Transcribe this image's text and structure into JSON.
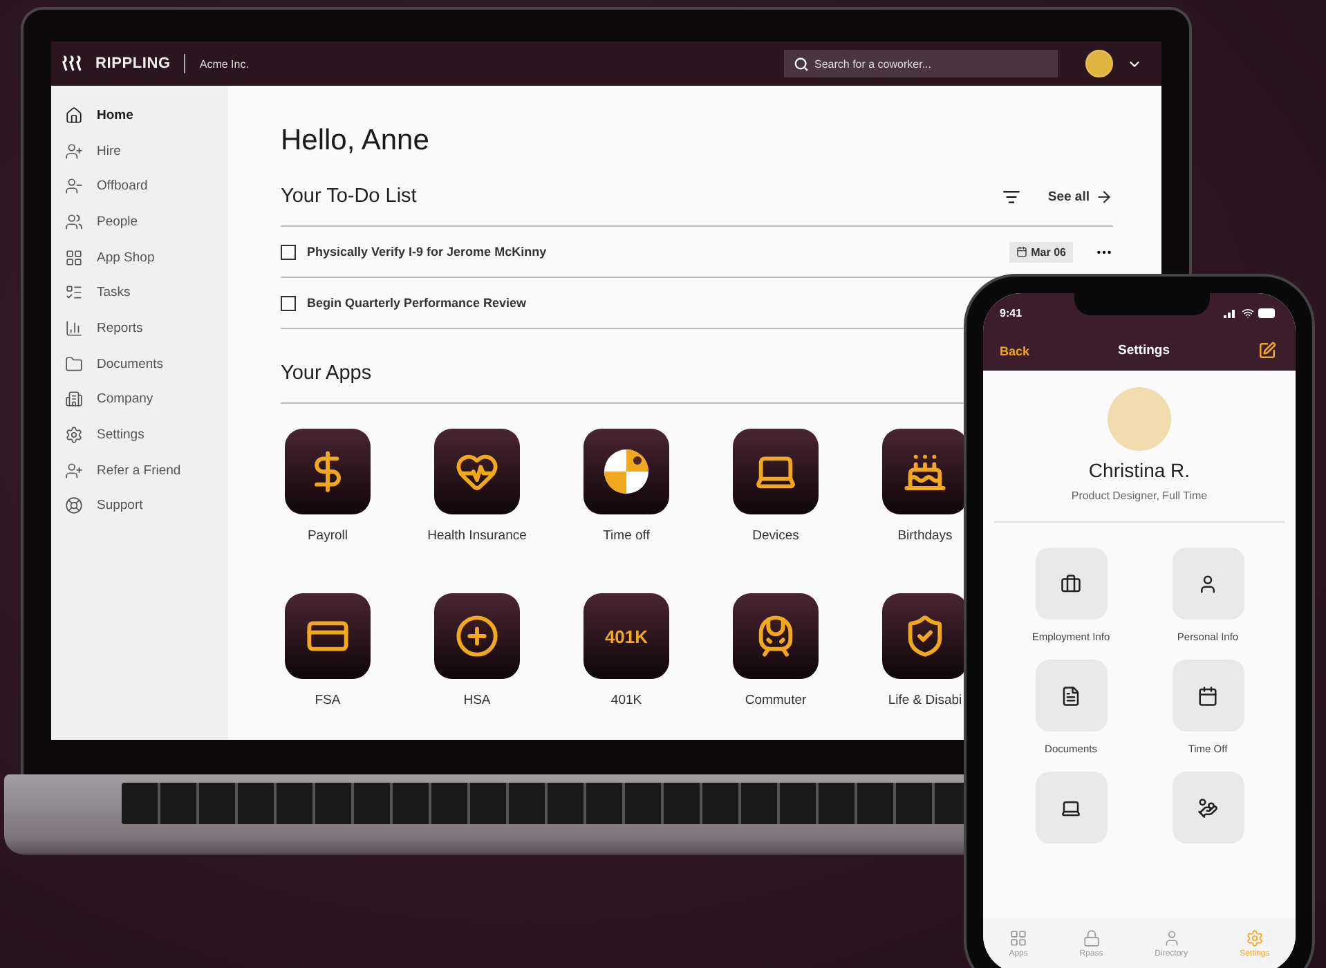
{
  "laptop": {
    "brand": "RIPPLING",
    "company": "Acme Inc.",
    "search": {
      "placeholder": "Search for a coworker..."
    }
  },
  "sidebar": {
    "items": [
      {
        "label": "Home",
        "kind": "home",
        "selected": true
      },
      {
        "label": "Hire",
        "kind": "hire",
        "selected": false
      },
      {
        "label": "Offboard",
        "kind": "offboard",
        "selected": false
      },
      {
        "label": "People",
        "kind": "people",
        "selected": false
      },
      {
        "label": "App Shop",
        "kind": "shop",
        "selected": false
      },
      {
        "label": "Tasks",
        "kind": "tasks",
        "selected": false
      },
      {
        "label": "Reports",
        "kind": "reports",
        "selected": false
      },
      {
        "label": "Documents",
        "kind": "documents",
        "selected": false
      },
      {
        "label": "Company",
        "kind": "company",
        "selected": false
      },
      {
        "label": "Settings",
        "kind": "settings",
        "selected": false
      },
      {
        "label": "Refer a Friend",
        "kind": "hire",
        "selected": false
      },
      {
        "label": "Support",
        "kind": "support",
        "selected": false
      }
    ]
  },
  "greeting": "Hello, Anne",
  "todo": {
    "title": "Your To-Do List",
    "see_all": "See all",
    "items": [
      {
        "label": "Physically Verify I-9 for Jerome McKinny",
        "checked": false,
        "date": "Mar 06"
      },
      {
        "label": "Begin Quarterly Performance Review",
        "checked": false
      }
    ]
  },
  "apps": {
    "title": "Your Apps",
    "items": [
      {
        "label": "Payroll",
        "kind": "payroll"
      },
      {
        "label": "Health Insurance",
        "kind": "heart-pulse"
      },
      {
        "label": "Time off",
        "kind": "ball"
      },
      {
        "label": "Devices",
        "kind": "laptop"
      },
      {
        "label": "Birthdays",
        "kind": "cake"
      },
      {
        "label": "FSA",
        "kind": "card"
      },
      {
        "label": "HSA",
        "kind": "plus"
      },
      {
        "label": "401K",
        "kind": "text",
        "icon_text": "401K"
      },
      {
        "label": "Commuter",
        "kind": "train"
      },
      {
        "label": "Life & Disabi",
        "kind": "shield"
      }
    ]
  },
  "phone": {
    "time": "9:41",
    "back": "Back",
    "title": "Settings",
    "name": "Christina R.",
    "role": "Product Designer, Full Time",
    "tiles": [
      {
        "label": "Employment Info",
        "kind": "employment"
      },
      {
        "label": "Personal Info",
        "kind": "personal"
      },
      {
        "label": "Documents",
        "kind": "documents"
      },
      {
        "label": "Time Off",
        "kind": "timeoff"
      },
      {
        "kind": "devices"
      },
      {
        "kind": "pay"
      }
    ],
    "tabs": [
      {
        "label": "Apps",
        "kind": "apps",
        "selected": false
      },
      {
        "label": "Rpass",
        "kind": "rpass",
        "selected": false
      },
      {
        "label": "Directory",
        "kind": "directory",
        "selected": false
      },
      {
        "label": "Settings",
        "kind": "settings",
        "selected": true
      }
    ]
  }
}
